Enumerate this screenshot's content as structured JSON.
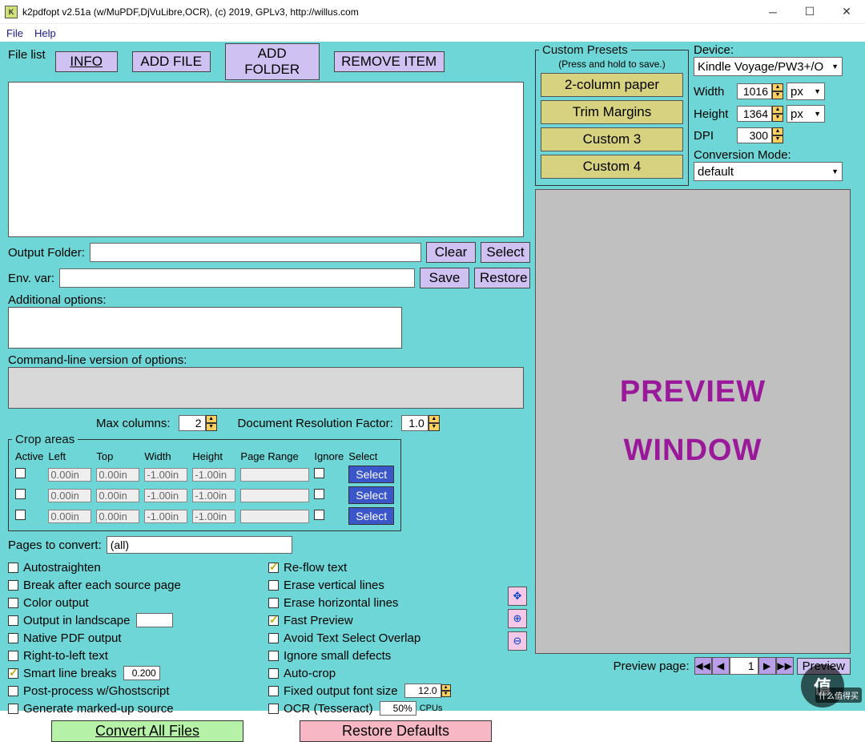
{
  "titlebar": {
    "icon": "K",
    "title": "k2pdfopt v2.51a (w/MuPDF,DjVuLibre,OCR), (c) 2019, GPLv3, http://willus.com"
  },
  "menu": {
    "file": "File",
    "help": "Help"
  },
  "filelist": {
    "label": "File list",
    "info": "INFO",
    "addfile": "ADD FILE",
    "addfolder": "ADD FOLDER",
    "remove": "REMOVE ITEM"
  },
  "presets": {
    "legend": "Custom Presets",
    "hint": "(Press and hold to save.)",
    "items": [
      "2-column paper",
      "Trim Margins",
      "Custom 3",
      "Custom 4"
    ]
  },
  "device": {
    "label": "Device:",
    "selected": "Kindle Voyage/PW3+/O",
    "width_lbl": "Width",
    "width_val": "1016",
    "width_unit": "px",
    "height_lbl": "Height",
    "height_val": "1364",
    "height_unit": "px",
    "dpi_lbl": "DPI",
    "dpi_val": "300",
    "mode_lbl": "Conversion Mode:",
    "mode_val": "default"
  },
  "outfolder": {
    "label": "Output Folder:",
    "clear": "Clear",
    "select": "Select"
  },
  "envvar": {
    "label": "Env. var:",
    "save": "Save",
    "restore": "Restore"
  },
  "addopts": {
    "label": "Additional options:"
  },
  "cmdline": {
    "label": "Command-line version of options:"
  },
  "params": {
    "maxcols_lbl": "Max columns:",
    "maxcols_val": "2",
    "docres_lbl": "Document Resolution Factor:",
    "docres_val": "1.0"
  },
  "crop": {
    "legend": "Crop areas",
    "head": [
      "Active",
      "Left",
      "Top",
      "Width",
      "Height",
      "Page Range",
      "Ignore",
      "Select"
    ],
    "rows": [
      {
        "active": false,
        "left": "0.00in",
        "top": "0.00in",
        "width": "-1.00in",
        "height": "-1.00in",
        "pr": "",
        "ignore": false,
        "sel": "Select"
      },
      {
        "active": false,
        "left": "0.00in",
        "top": "0.00in",
        "width": "-1.00in",
        "height": "-1.00in",
        "pr": "",
        "ignore": false,
        "sel": "Select"
      },
      {
        "active": false,
        "left": "0.00in",
        "top": "0.00in",
        "width": "-1.00in",
        "height": "-1.00in",
        "pr": "",
        "ignore": false,
        "sel": "Select"
      }
    ]
  },
  "pages": {
    "label": "Pages to convert:",
    "val": "(all)"
  },
  "options_left": [
    {
      "checked": false,
      "label": "Autostraighten"
    },
    {
      "checked": false,
      "label": "Break after each source page"
    },
    {
      "checked": false,
      "label": "Color output"
    },
    {
      "checked": false,
      "label": "Output in landscape",
      "extra_input": ""
    },
    {
      "checked": false,
      "label": "Native PDF output"
    },
    {
      "checked": false,
      "label": "Right-to-left text"
    },
    {
      "checked": true,
      "label": "Smart line breaks",
      "extra_input": "0.200"
    },
    {
      "checked": false,
      "label": "Post-process w/Ghostscript"
    },
    {
      "checked": false,
      "label": "Generate marked-up source"
    }
  ],
  "options_right": [
    {
      "checked": true,
      "label": "Re-flow text"
    },
    {
      "checked": false,
      "label": "Erase vertical lines"
    },
    {
      "checked": false,
      "label": "Erase horizontal lines"
    },
    {
      "checked": true,
      "label": "Fast Preview"
    },
    {
      "checked": false,
      "label": "Avoid Text Select Overlap"
    },
    {
      "checked": false,
      "label": "Ignore small defects"
    },
    {
      "checked": false,
      "label": "Auto-crop"
    },
    {
      "checked": false,
      "label": "Fixed output font size",
      "extra_input": "12.0",
      "spin": true
    },
    {
      "checked": false,
      "label": "OCR (Tesseract)",
      "extra_input": "50%",
      "suffix": "CPUs"
    }
  ],
  "mainbtns": {
    "convert": "Convert All Files",
    "restore": "Restore Defaults"
  },
  "preview": {
    "placeholder1": "PREVIEW",
    "placeholder2": "WINDOW",
    "page_lbl": "Preview page:",
    "page_val": "1",
    "preview_lbl": "Preview"
  },
  "watermark": {
    "main": "值",
    "tail": "什么值得买"
  }
}
